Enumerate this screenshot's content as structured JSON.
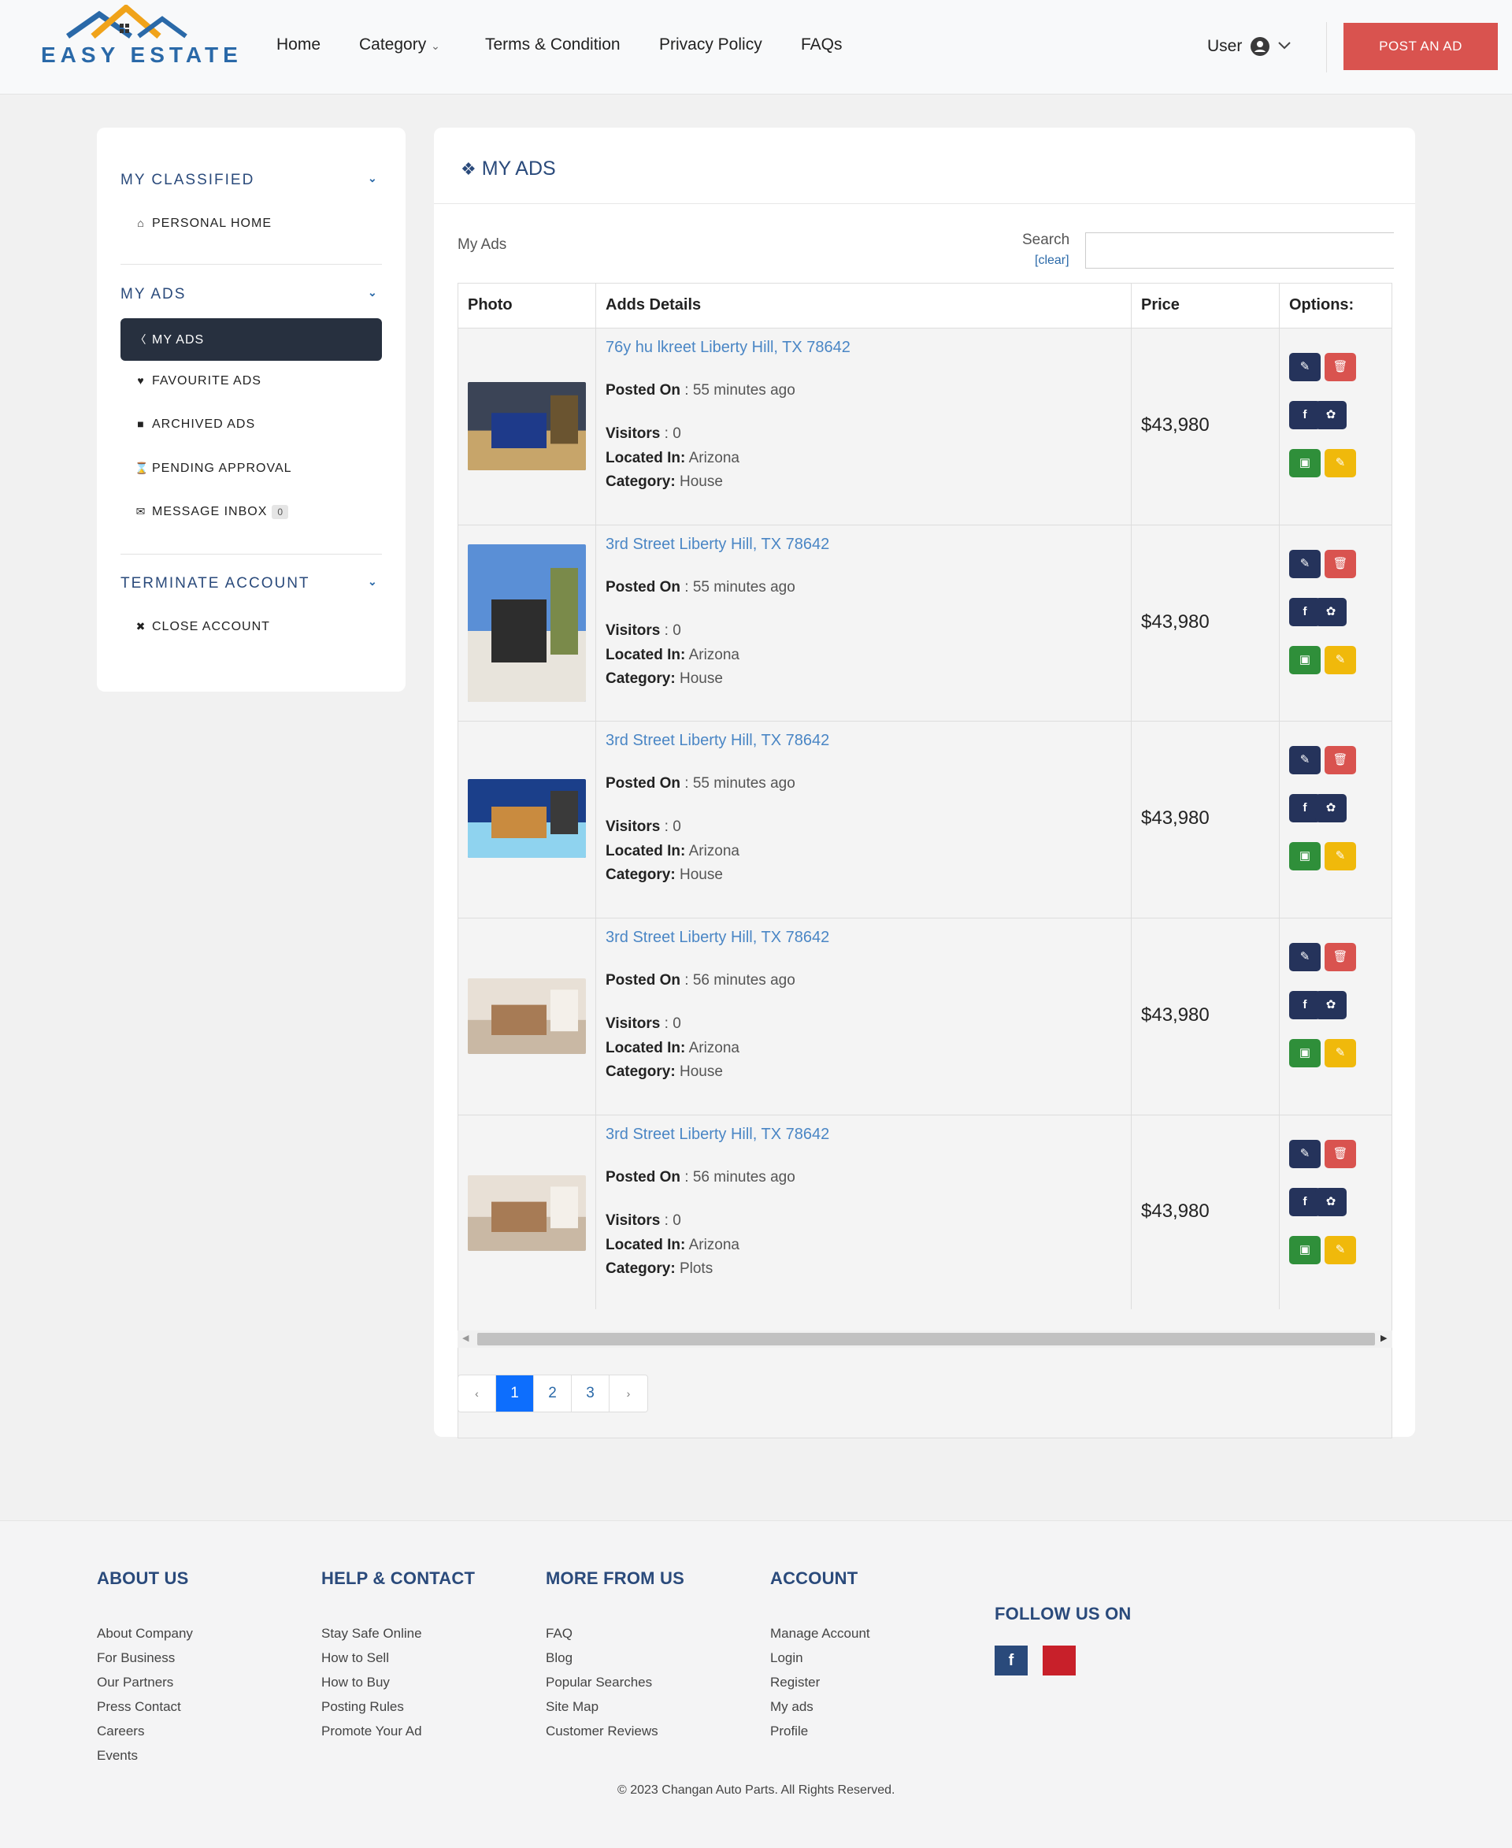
{
  "brand": {
    "name": "EASY ESTATE"
  },
  "nav": {
    "home": "Home",
    "category": "Category",
    "terms": "Terms & Condition",
    "privacy": "Privacy Policy",
    "faqs": "FAQs",
    "user": "User",
    "post_ad": "POST AN AD"
  },
  "sidebar": {
    "classified_heading": "MY CLASSIFIED",
    "personal_home": "PERSONAL HOME",
    "my_ads_heading": "MY ADS",
    "my_ads": "MY ADS",
    "favourite": "FAVOURITE ADS",
    "archived": "ARCHIVED ADS",
    "pending": "PENDING APPROVAL",
    "inbox": "MESSAGE INBOX",
    "inbox_count": "0",
    "terminate_heading": "TERMINATE ACCOUNT",
    "close_account": "CLOSE ACCOUNT"
  },
  "main": {
    "title": "MY ADS",
    "caption": "My Ads",
    "search_label": "Search",
    "search_clear": "[clear]",
    "search_value": "",
    "columns": {
      "photo": "Photo",
      "details": "Adds Details",
      "price": "Price",
      "options": "Options:"
    },
    "labels": {
      "posted": "Posted On",
      "visitors": "Visitors",
      "located": "Located In:",
      "category": "Category:"
    },
    "ads": [
      {
        "title": "76y hu lkreet Liberty Hill, TX 78642",
        "posted": ": 55 minutes ago",
        "visitors": ": 0",
        "location": "Arizona",
        "category": "House",
        "price": "$43,980"
      },
      {
        "title": "3rd Street Liberty Hill, TX 78642",
        "posted": ": 55 minutes ago",
        "visitors": ": 0",
        "location": "Arizona",
        "category": "House",
        "price": "$43,980"
      },
      {
        "title": "3rd Street Liberty Hill, TX 78642",
        "posted": ": 55 minutes ago",
        "visitors": ": 0",
        "location": "Arizona",
        "category": "House",
        "price": "$43,980"
      },
      {
        "title": "3rd Street Liberty Hill, TX 78642",
        "posted": ": 56 minutes ago",
        "visitors": ": 0",
        "location": "Arizona",
        "category": "House",
        "price": "$43,980"
      },
      {
        "title": "3rd Street Liberty Hill, TX 78642",
        "posted": ": 56 minutes ago",
        "visitors": ": 0",
        "location": "Arizona",
        "category": "Plots",
        "price": "$43,980"
      }
    ],
    "pagination": {
      "prev": "‹",
      "pages": [
        "1",
        "2",
        "3"
      ],
      "next": "›",
      "current": "1"
    }
  },
  "footer": {
    "about": {
      "heading": "ABOUT US",
      "links": [
        "About Company",
        "For Business",
        "Our Partners",
        "Press Contact",
        "Careers",
        "Events"
      ]
    },
    "help": {
      "heading": "HELP & CONTACT",
      "links": [
        "Stay Safe Online",
        "How to Sell",
        "How to Buy",
        "Posting Rules",
        "Promote Your Ad"
      ]
    },
    "more": {
      "heading": "MORE FROM US",
      "links": [
        "FAQ",
        "Blog",
        "Popular Searches",
        "Site Map",
        "Customer Reviews"
      ]
    },
    "account": {
      "heading": "ACCOUNT",
      "links": [
        "Manage Account",
        "Login",
        "Register",
        "My ads",
        "Profile"
      ]
    },
    "follow": {
      "heading": "FOLLOW US ON"
    },
    "copyright": "© 2023 Changan Auto Parts. All Rights Reserved."
  },
  "colors": {
    "primary": "#2a4a7b",
    "accent_red": "#d9534f",
    "link_blue": "#4a86c5",
    "active_page": "#0d6efd"
  }
}
